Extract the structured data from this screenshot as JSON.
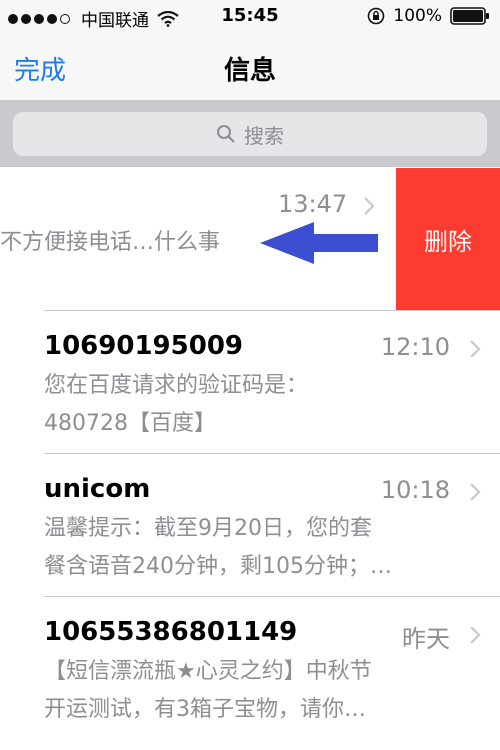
{
  "status_bar": {
    "carrier": "中国联通",
    "time": "15:45",
    "battery": "100%"
  },
  "nav": {
    "done_label": "完成",
    "title": "信息"
  },
  "search": {
    "placeholder": "搜索"
  },
  "swiped_row": {
    "time": "13:47",
    "preview": "不方便接电话…什么事",
    "delete_label": "删除"
  },
  "messages": [
    {
      "sender": "10690195009",
      "time": "12:10",
      "line1": "您在百度请求的验证码是：",
      "line2": "480728【百度】"
    },
    {
      "sender": "unicom",
      "time": "10:18",
      "line1": "温馨提示：截至9月20日，您的套",
      "line2": "餐含语音240分钟，剩105分钟；…"
    },
    {
      "sender": "10655386801149",
      "time": "昨天",
      "line1": "【短信漂流瓶★心灵之约】中秋节",
      "line2": "开运测试，有3箱子宝物，请你…"
    }
  ],
  "colors": {
    "accent": "#1a7cf5",
    "delete": "#fe3b30",
    "annotation_arrow": "#3d4fd1"
  }
}
